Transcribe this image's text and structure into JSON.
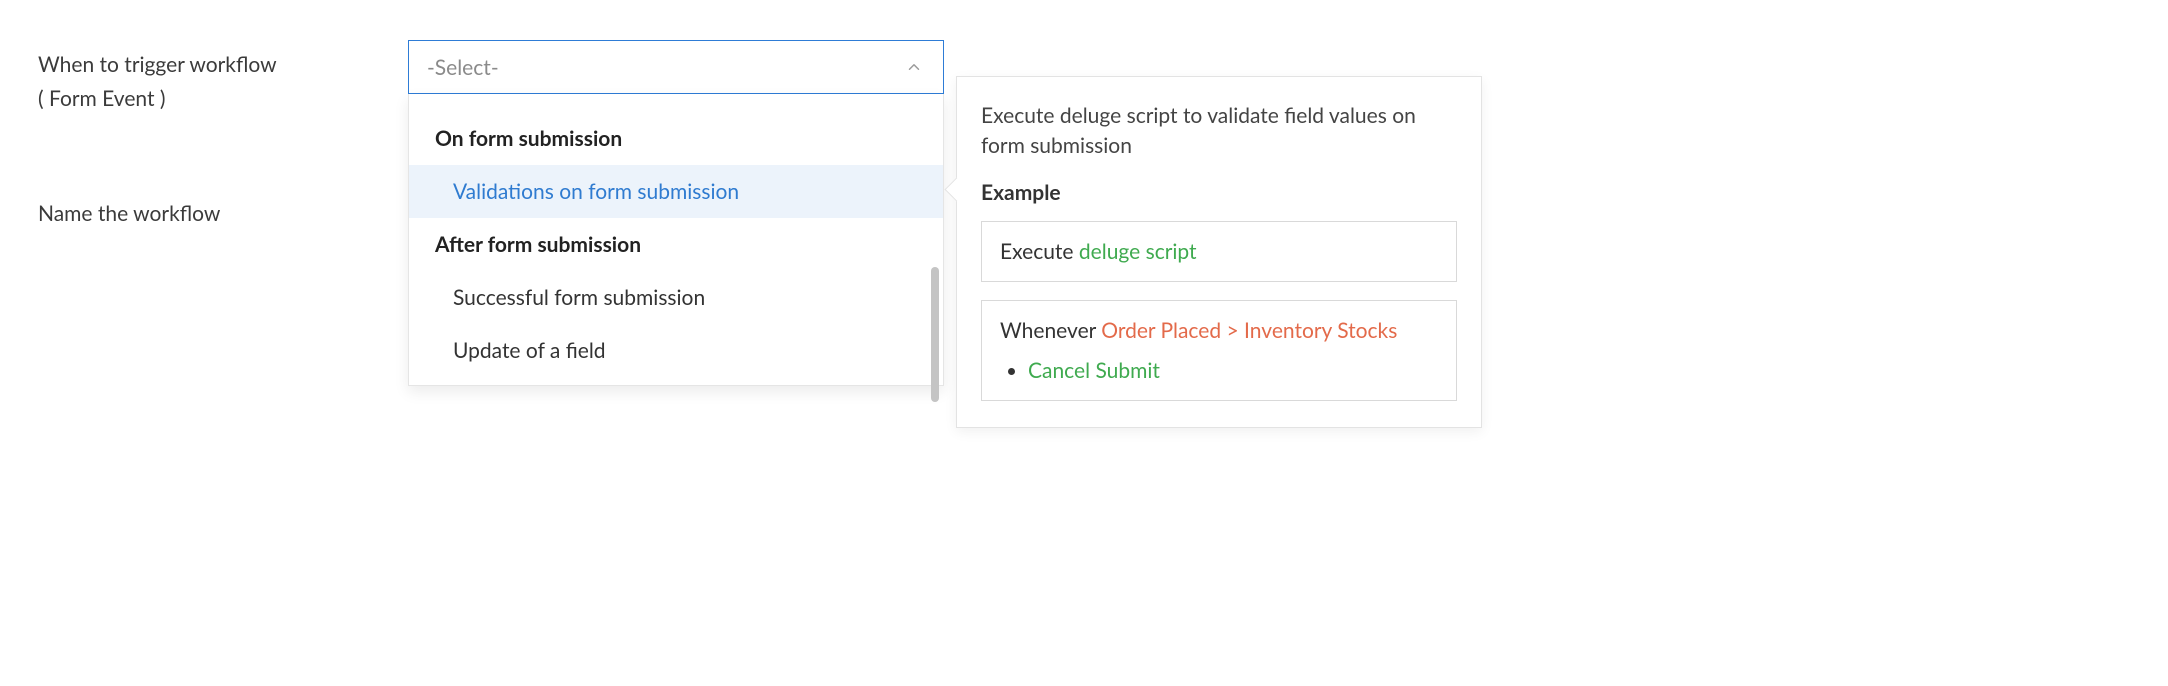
{
  "labels": {
    "trigger_line1": "When to trigger workflow",
    "trigger_line2": "( Form Event )",
    "name_workflow": "Name the workflow"
  },
  "select": {
    "placeholder": "-Select-"
  },
  "dropdown": {
    "group1": {
      "header": "On form submission",
      "item1": "Validations on form submission"
    },
    "group2": {
      "header": "After form submission",
      "item1": "Successful form submission",
      "item2": "Update of a field"
    }
  },
  "info": {
    "desc": "Execute deluge script to validate field values on form submission",
    "example_label": "Example",
    "box1": {
      "prefix": "Execute ",
      "link": "deluge script"
    },
    "box2": {
      "prefix": "Whenever ",
      "cond": "Order Placed > Inventory Stocks",
      "bullet": "Cancel Submit"
    }
  }
}
